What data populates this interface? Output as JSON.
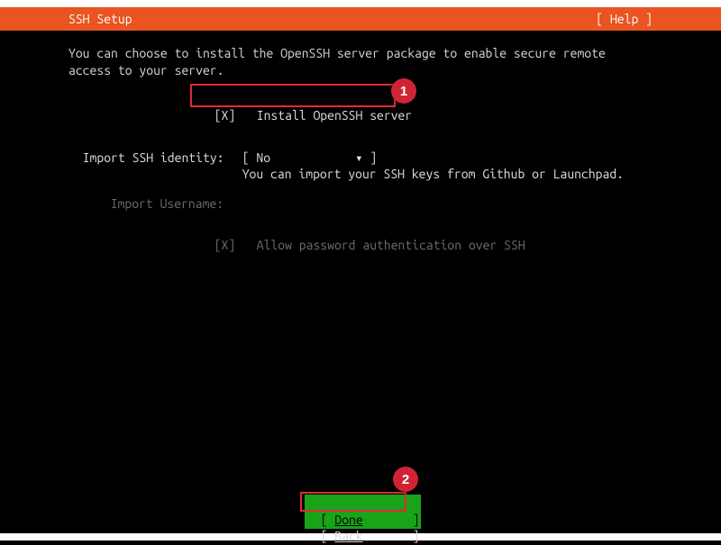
{
  "header": {
    "title": "SSH Setup",
    "help": "[ Help ]"
  },
  "intro_line1": "You can choose to install the OpenSSH server package to enable secure remote",
  "intro_line2": "access to your server.",
  "install_checkbox": {
    "marker": "[X]",
    "label": "Install OpenSSH server"
  },
  "import_identity": {
    "label": "Import SSH identity:",
    "value": "[ No            ▾ ]",
    "hint": "You can import your SSH keys from Github or Launchpad."
  },
  "import_username_label": "Import Username:",
  "allow_password": {
    "marker": "[X]",
    "label": "Allow password authentication over SSH"
  },
  "buttons": {
    "done_open": "[ ",
    "done_text": "Done",
    "done_close": "       ]",
    "back_open": "[ ",
    "back_text": "Back",
    "back_close": "       ]"
  },
  "callouts": {
    "badge1": "1",
    "badge2": "2"
  }
}
